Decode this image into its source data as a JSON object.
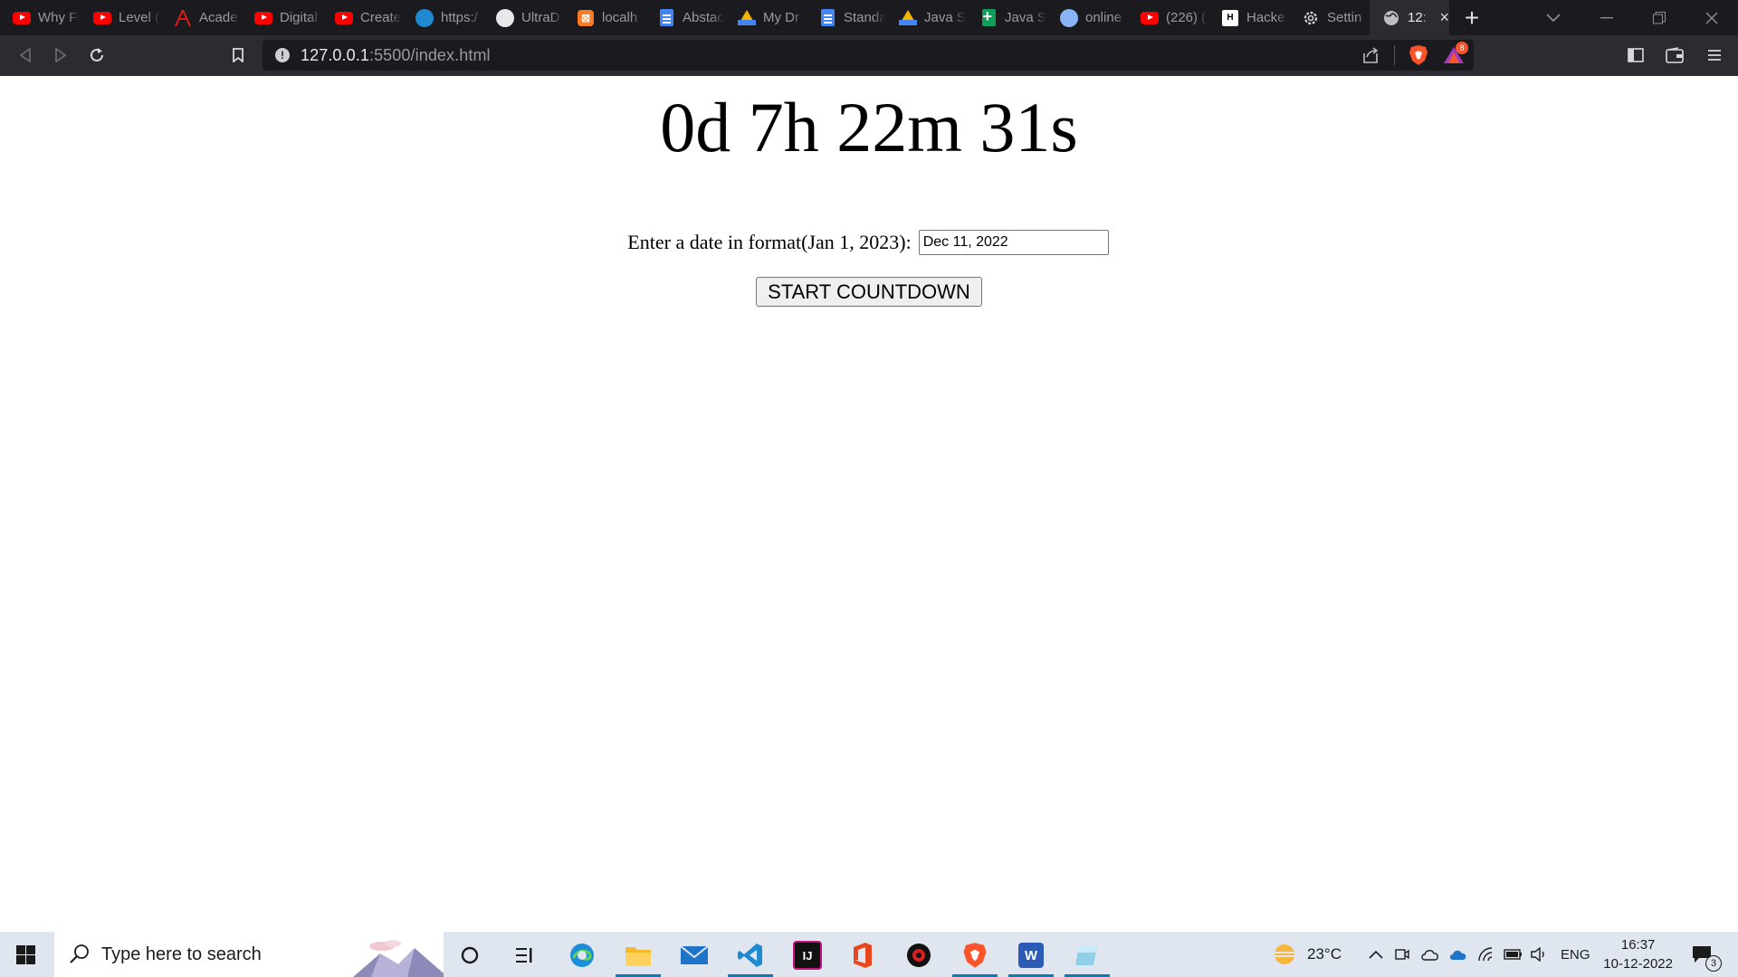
{
  "browser": {
    "tabs": [
      {
        "title": "Why Fi",
        "icon": "youtube-icon"
      },
      {
        "title": "Level (",
        "icon": "youtube-icon"
      },
      {
        "title": "Acade",
        "icon": "angular-icon"
      },
      {
        "title": "Digital",
        "icon": "youtube-icon"
      },
      {
        "title": "Create",
        "icon": "youtube-icon"
      },
      {
        "title": "https:/",
        "icon": "globe-blue-icon"
      },
      {
        "title": "UltraD",
        "icon": "github-icon"
      },
      {
        "title": "localh",
        "icon": "xampp-icon"
      },
      {
        "title": "Abstac",
        "icon": "google-docs-icon"
      },
      {
        "title": "My Dr",
        "icon": "google-drive-icon"
      },
      {
        "title": "Standa",
        "icon": "google-docs-icon"
      },
      {
        "title": "Java S",
        "icon": "google-drive-icon"
      },
      {
        "title": "Java S",
        "icon": "google-sheets-icon"
      },
      {
        "title": "online",
        "icon": "info-icon"
      },
      {
        "title": "(226) (",
        "icon": "youtube-icon"
      },
      {
        "title": "Hacke",
        "icon": "hackerrank-icon"
      },
      {
        "title": "Settin",
        "icon": "gear-icon"
      }
    ],
    "active_tab": {
      "title": "12:",
      "icon": "globe-icon",
      "close": "×"
    },
    "new_tab": "+",
    "url_host": "127.0.0.1",
    "url_path": ":5500/index.html",
    "brave_badge": "8"
  },
  "page": {
    "countdown": "0d 7h 22m 31s",
    "date_label": "Enter a date in format(Jan 1, 2023):",
    "date_value": "Dec 11, 2022",
    "start_button": "START COUNTDOWN"
  },
  "taskbar": {
    "search_placeholder": "Type here to search",
    "temperature": "23°C",
    "language": "ENG",
    "time": "16:37",
    "date": "10-12-2022",
    "notification_count": "3"
  },
  "colors": {
    "youtube": "#ff0000",
    "brave": "#fb542b",
    "taskbar_accent": "#0a7ab8"
  }
}
